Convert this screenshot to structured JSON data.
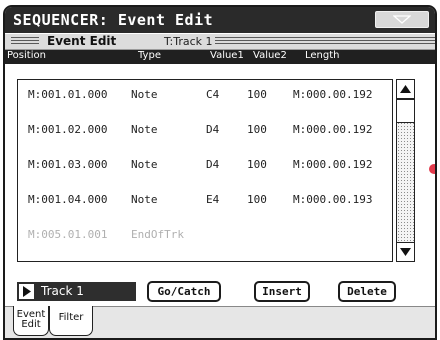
{
  "window": {
    "title": "SEQUENCER: Event Edit"
  },
  "page": {
    "name": "Event Edit",
    "track_label": "T:Track 1"
  },
  "columns": [
    "Position",
    "Type",
    "Value1",
    "Value2",
    "Length"
  ],
  "events": [
    {
      "position": "M:001.01.000",
      "type": "Note",
      "value1": "C4",
      "value2": "100",
      "length": "M:000.00.192"
    },
    {
      "position": "M:001.02.000",
      "type": "Note",
      "value1": "D4",
      "value2": "100",
      "length": "M:000.00.192"
    },
    {
      "position": "M:001.03.000",
      "type": "Note",
      "value1": "D4",
      "value2": "100",
      "length": "M:000.00.192"
    },
    {
      "position": "M:001.04.000",
      "type": "Note",
      "value1": "E4",
      "value2": "100",
      "length": "M:000.00.193"
    },
    {
      "position": "M:005.01.001",
      "type": "EndOfTrk",
      "value1": "",
      "value2": "",
      "length": ""
    }
  ],
  "track_selector": {
    "value": "Track 1"
  },
  "buttons": {
    "go_catch": "Go/Catch",
    "insert": "Insert",
    "delete": "Delete"
  },
  "tabs": [
    {
      "line1": "Event",
      "line2": "Edit"
    },
    {
      "label": "Filter"
    }
  ],
  "colors": {
    "titlebar": "#2a2a2a",
    "header": "#dcdcdc",
    "accent": "#e23a4b"
  }
}
